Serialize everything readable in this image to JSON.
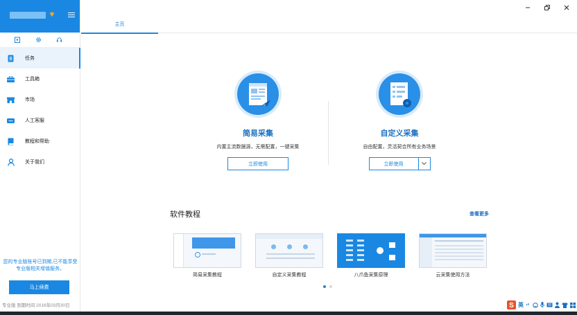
{
  "sidebar": {
    "items": [
      {
        "label": "任务",
        "icon": "task-icon"
      },
      {
        "label": "工具箱",
        "icon": "toolbox-icon"
      },
      {
        "label": "市场",
        "icon": "market-icon"
      },
      {
        "label": "人工客服",
        "icon": "customer-service-icon"
      },
      {
        "label": "教程和帮助",
        "icon": "book-icon"
      },
      {
        "label": "关于我们",
        "icon": "user-icon"
      }
    ],
    "expire_notice": "您的专业版账号已到期,已不能享受专业版相关增值服务。",
    "renew_label": "马上续费",
    "plan_info": "专业版 到期时间 2016年03月30日"
  },
  "tabs": {
    "home": "主页"
  },
  "features": {
    "simple": {
      "title": "简易采集",
      "desc": "内置主流数据源，无需配置，一键采集",
      "button": "立即使用"
    },
    "custom": {
      "title": "自定义采集",
      "desc": "自由配置，灵活契合所有业务场景",
      "button": "立即使用"
    }
  },
  "tutorials": {
    "title": "软件教程",
    "more": "查看更多",
    "cards": [
      {
        "label": "简易采集教程"
      },
      {
        "label": "自定义采集教程"
      },
      {
        "label": "八爪鱼采集原理"
      },
      {
        "label": "云采集使用方法"
      }
    ]
  },
  "ime": {
    "lang": "英"
  },
  "colors": {
    "accent": "#1a88e2",
    "title": "#1a6fc0",
    "ime_brand": "#e8542b"
  }
}
